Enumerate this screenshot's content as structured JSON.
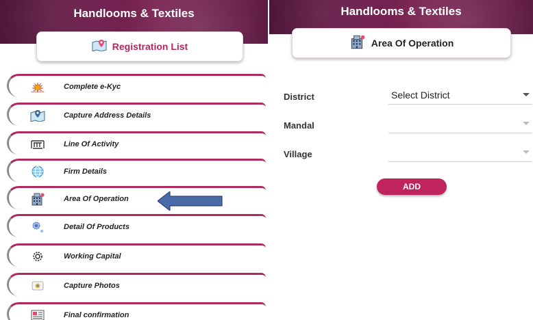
{
  "left": {
    "app_title": "Handlooms & Textiles",
    "card_title": "Registration List",
    "card_icon": "map-marker-icon",
    "menu": [
      {
        "label": "Complete e-Kyc",
        "icon": "aadhaar-icon"
      },
      {
        "label": "Capture Address Details",
        "icon": "map-marker-icon"
      },
      {
        "label": "Line Of Activity",
        "icon": "loom-icon"
      },
      {
        "label": "Firm Details",
        "icon": "globe-icon"
      },
      {
        "label": "Area Of Operation",
        "icon": "building-icon"
      },
      {
        "label": "Detail Of Products",
        "icon": "products-icon"
      },
      {
        "label": "Working Capital",
        "icon": "gear-icon"
      },
      {
        "label": "Capture Photos",
        "icon": "camera-icon"
      },
      {
        "label": "Final confirmation",
        "icon": "document-icon"
      }
    ]
  },
  "right": {
    "app_title": "Handlooms & Textiles",
    "card_title": "Area Of Operation",
    "card_icon": "building-icon",
    "fields": [
      {
        "label": "District",
        "value": "Select District"
      },
      {
        "label": "Mandal",
        "value": ""
      },
      {
        "label": "Village",
        "value": ""
      }
    ],
    "add_label": "ADD"
  },
  "colors": {
    "header": "#6d1c4c",
    "accent": "#b3265e",
    "button": "#c0245c",
    "arrow": "#4a6aa8"
  }
}
